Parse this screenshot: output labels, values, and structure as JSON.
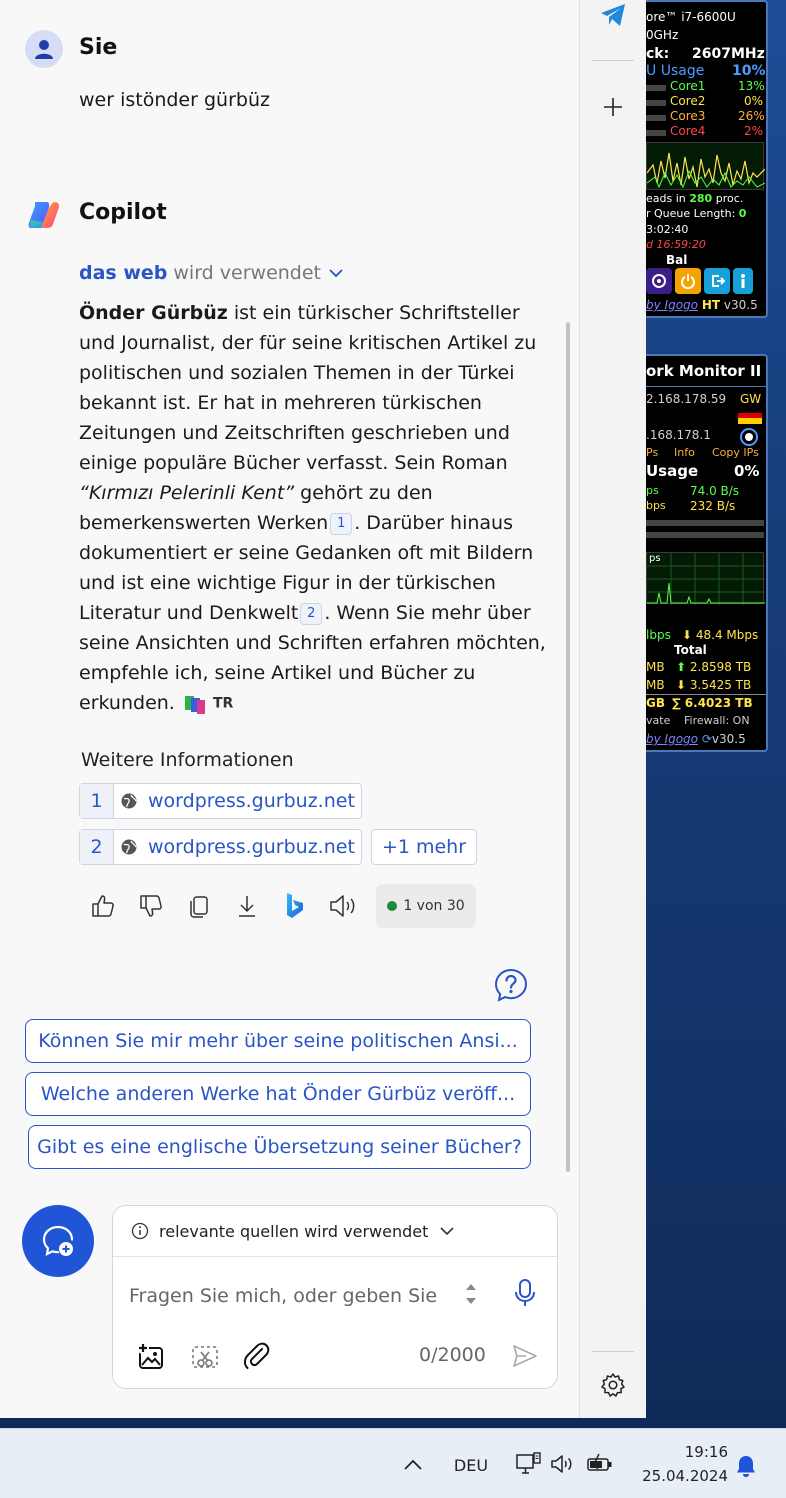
{
  "user": {
    "name": "Sie",
    "message": "wer istönder gürbüz"
  },
  "copilot": {
    "name": "Copilot",
    "source_prefix": "das web",
    "source_suffix": "wird verwendet",
    "answer": {
      "p1_bold": "Önder Gürbüz",
      "p1": " ist ein türkischer Schriftsteller und Journalist, der für seine kritischen Artikel zu politischen und sozialen Themen in der Türkei bekannt ist. Er hat in mehreren türkischen Zeitungen und Zeitschriften geschrieben und einige populäre Bücher verfasst. Sein Roman ",
      "p1_italic": "“Kırmızı Pelerinli Kent”",
      "p2": " gehört zu den bemerkenswerten Werken",
      "cite1": "1",
      "p3": ". Darüber hinaus dokumentiert er seine Gedanken oft mit Bildern und ist eine wichtige Figur in der türkischen Literatur und Denkwelt",
      "cite2": "2",
      "p4": ". Wenn Sie mehr über seine Ansichten und Schriften erfahren möchten, empfehle ich, seine Artikel und Bücher zu erkunden.",
      "lang": "TR"
    },
    "more_info_label": "Weitere Informationen",
    "sources": [
      {
        "num": "1",
        "label": "wordpress.gurbuz.net"
      },
      {
        "num": "2",
        "label": "wordpress.gurbuz.net"
      }
    ],
    "more_chip": "+1 mehr",
    "counter": "1 von 30"
  },
  "suggestions": [
    "Können Sie mir mehr über seine politischen Ansi...",
    "Welche anderen Werke hat Önder Gürbüz veröff...",
    "Gibt es eine englische Übersetzung seiner Bücher?"
  ],
  "input": {
    "mode_label": "relevante quellen wird verwendet",
    "placeholder": "Fragen Sie mich, oder geben Sie",
    "char_count": "0/2000"
  },
  "gadget_system": {
    "cpu_name": "ore™ i7-6600U",
    "cpu_freq": "0GHz",
    "clock_label": "ck:",
    "clock_value": "2607MHz",
    "usage_label": "U Usage",
    "usage_value": "10%",
    "cores": [
      {
        "name": "Core1",
        "value": "13%"
      },
      {
        "name": "Core2",
        "value": "0%"
      },
      {
        "name": "Core3",
        "value": "26%"
      },
      {
        "name": "Core4",
        "value": "2%"
      }
    ],
    "threads_pre": "eads in ",
    "threads_value": "280",
    "threads_post": " proc.",
    "queue_label": "r Queue Length: ",
    "queue_value": "0",
    "time1": "3:02:40",
    "time2": "d 16:59:20",
    "bal": "Bal",
    "footer_link": "by Igogo",
    "footer_ht": "HT",
    "footer_ver": "v30.5"
  },
  "gadget_network": {
    "title": "ork Monitor II",
    "ip1": "2.168.178.59",
    "gw": "GW",
    "ip2": ".168.178.1",
    "links": [
      "Ps",
      "Info",
      "Copy IPs"
    ],
    "usage_label": "Usage",
    "usage_value": "0%",
    "down_label": "ps",
    "down_value": "74.0 B/s",
    "up_label": "bps",
    "up_value": "232 B/s",
    "graph_label": "ps",
    "speed_left": "lbps",
    "speed_right": "48.4 Mbps",
    "total_label": "Total",
    "total_up_left": "MB",
    "total_up_value": "2.8598 TB",
    "total_down_left": "MB",
    "total_down_value": "3.5425 TB",
    "sum_left": "GB",
    "sum_value": "6.4023 TB",
    "private": "vate",
    "firewall": "Firewall: ON",
    "footer_link": "by Igogo",
    "footer_ver": "v30.5"
  },
  "taskbar": {
    "language": "DEU",
    "time": "19:16",
    "date": "25.04.2024"
  },
  "colors": {
    "accent": "#2a55c7",
    "new_chat": "#1f55d6"
  }
}
